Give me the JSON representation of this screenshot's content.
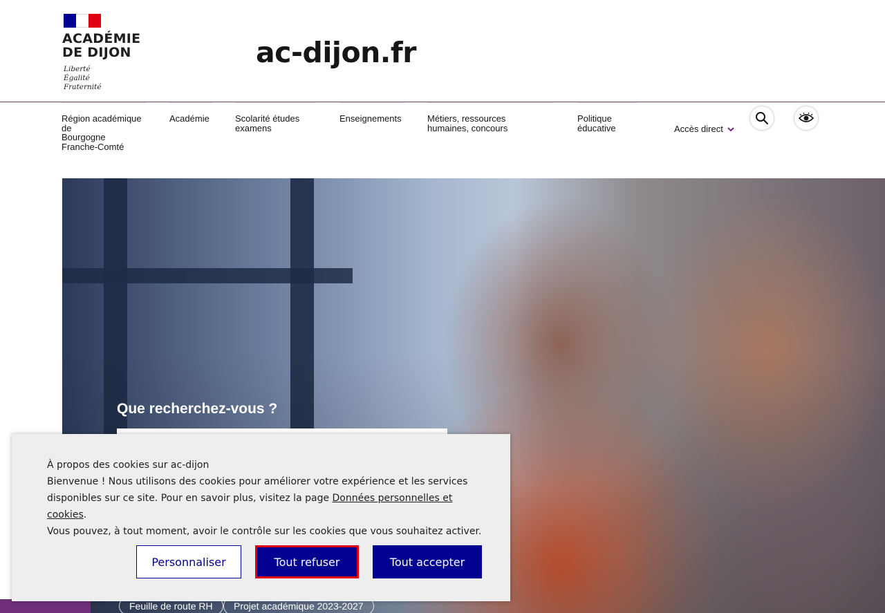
{
  "header": {
    "logo": {
      "title_lines": [
        "ACADÉMIE",
        "DE DIJON"
      ],
      "motto_lines": [
        "Liberté",
        "Égalité",
        "Fraternité"
      ]
    },
    "site_name": "ac-dijon.fr"
  },
  "nav": {
    "items": [
      {
        "lines": [
          "Région académique",
          "de",
          "Bourgogne",
          "Franche-Comté"
        ]
      },
      {
        "lines": [
          "Académie"
        ]
      },
      {
        "lines": [
          "Scolarité études",
          "examens"
        ]
      },
      {
        "lines": [
          "Enseignements"
        ]
      },
      {
        "lines": [
          "Métiers, ressources",
          "humaines, concours"
        ]
      },
      {
        "lines": [
          "Politique",
          "éducative"
        ]
      }
    ],
    "acces_direct": "Accès direct",
    "search_icon": "search-icon",
    "accessibility_icon": "eye-icon"
  },
  "hero": {
    "search_label": "Que recherchez-vous ?",
    "search_value": "",
    "links": [
      "Feuille de route RH",
      "Projet académique 2023-2027"
    ]
  },
  "cookie_banner": {
    "title": "À propos des cookies sur ac-dijon",
    "text_before_link": "Bienvenue ! Nous utilisons des cookies pour améliorer votre expérience et les services disponibles sur ce site. Pour en savoir plus, visitez la page ",
    "link_text": "Données personnelles et cookies",
    "text_after_link": ".",
    "text_line_last": "Vous pouvez, à tout moment, avoir le contrôle sur les cookies que vous souhaitez activer.",
    "buttons": {
      "personalize": "Personnaliser",
      "refuse_all": "Tout refuser",
      "accept_all": "Tout accepter"
    }
  },
  "colors": {
    "primary_blue": "#000091",
    "red": "#e1000f",
    "nav_line": "#6e445a"
  }
}
